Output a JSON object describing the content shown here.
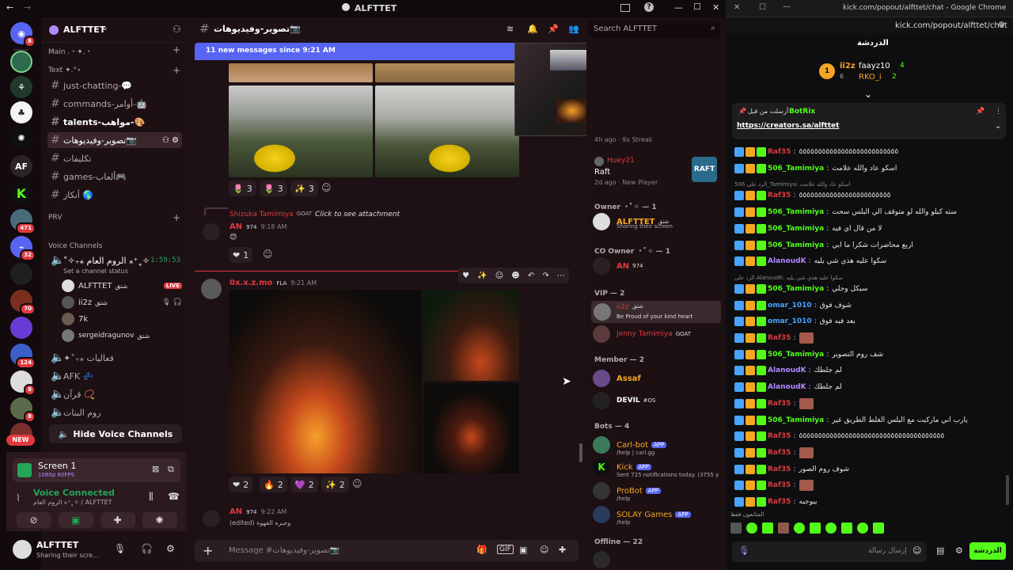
{
  "colors": {
    "accent": "#5865f2",
    "kick_green": "#53fc18",
    "live": "#e03a3e",
    "online": "#23a55a"
  },
  "titlebar": {
    "back": "←",
    "forward": "→",
    "server_name": "ALFTTET",
    "inbox": "inbox-icon",
    "help": "?",
    "min": "—",
    "max": "☐",
    "close": "✕"
  },
  "guilds": [
    {
      "name": "discord-home",
      "badge": "8"
    },
    {
      "name": "server-1"
    },
    {
      "name": "server-2"
    },
    {
      "name": "server-3"
    },
    {
      "name": "server-4"
    },
    {
      "name": "AF",
      "badge": ""
    },
    {
      "name": "K",
      "badge": ""
    },
    {
      "name": "server-7",
      "badge": "471"
    },
    {
      "name": "server-8",
      "badge": "32"
    },
    {
      "name": "server-9"
    },
    {
      "name": "server-10",
      "badge": "70"
    },
    {
      "name": "server-11"
    },
    {
      "name": "server-12",
      "badge": "124"
    },
    {
      "name": "server-13",
      "badge": "8"
    },
    {
      "name": "server-14",
      "badge": "8"
    },
    {
      "name": "server-15"
    },
    {
      "name": "NEW"
    }
  ],
  "server": {
    "name": "ALFTTET",
    "chevron": "⌄"
  },
  "channels": {
    "cat_main": "Main .・✦.・",
    "cat_text": "Text ✦.°⋆",
    "items": [
      "just-chatting-💬",
      "commands-أوامر-🤖",
      "talents-مواهب-🎨",
      "تصوير-وفيديوهات📷",
      "تكليفات",
      "games-ألعاب🎮",
      "أنكاز 🌎"
    ],
    "cat_prv": "PRV",
    "cat_voice": "Voice Channels",
    "voice1": "˚✧₊⁎ الروم العام ⁎⁺˳✧",
    "voice1_time": "1:59:53",
    "voice1_status": "Set a channel status",
    "users": [
      {
        "name": "ALFTTET",
        "tag": "شتق",
        "live": "LIVE"
      },
      {
        "name": "ii2z",
        "tag": "شتق"
      },
      {
        "name": "7k",
        "tag": ""
      },
      {
        "name": "sergeidragunov",
        "tag": "شتق"
      }
    ],
    "voice2": "✦˚₊⁎ فعاليات",
    "voice3": "AFK 💤",
    "voice4": "قرآن 📿",
    "voice5": "روم البنات",
    "hide_voice": "Hide Voice Channels"
  },
  "stream_panel": {
    "title": "Screen 1",
    "quality": "1080p 60FPS",
    "status": "Voice Connected",
    "location": "الروم العام ⁎⁺˳✧ / ALFTTET"
  },
  "user_panel": {
    "name": "ALFTTET",
    "status": "Sharing their scre..."
  },
  "header": {
    "channel": "تصوير-وفيديوهات📷",
    "search_placeholder": "Search ALFTTET"
  },
  "new_messages": {
    "text": "11 new messages since 9:21 AM",
    "mark": "M"
  },
  "messages": [
    {
      "author": "AN",
      "tag": "974",
      "time": "9:18 AM",
      "reply_author": "Shizuka Tamimiya",
      "reply_tag": "GOAT",
      "reply_text": "Click to see attachment",
      "body": "😊",
      "reaction": "1"
    },
    {
      "author": "0x.x.z.mo",
      "tag": "FLA",
      "time": "9:21 AM"
    },
    {
      "author": "AN",
      "tag": "974",
      "time": "9:22 AM",
      "body": "(edited) وجبره القهوة"
    }
  ],
  "reactions1": [
    {
      "emoji": "🌷",
      "count": "3"
    },
    {
      "emoji": "🌷",
      "count": "3"
    },
    {
      "emoji": "✨",
      "count": "3"
    }
  ],
  "reactions2": [
    {
      "emoji": "❤",
      "count": "2"
    },
    {
      "emoji": "🔥",
      "count": "2"
    },
    {
      "emoji": "💜",
      "count": "2"
    },
    {
      "emoji": "✨",
      "count": "2"
    }
  ],
  "composer": {
    "placeholder": "Message #تصوير-وفيديوهات📷"
  },
  "members": {
    "top_time": "4h ago",
    "top_streak": "9x Streak",
    "raft_name": "Raft",
    "raft_time": "2d ago",
    "raft_status": "New Player",
    "raft_user": "Huey21",
    "owner_head": "Owner ・ﾟ✧ — 1",
    "owner": {
      "name": "ALFTTET",
      "tag": "شتق",
      "status": "Sharing their screen"
    },
    "coowner_head": "CO Owner ・ﾟ✧ — 1",
    "coowner": {
      "name": "AN",
      "tag": "974"
    },
    "vip_head": "VIP — 2",
    "vip1": {
      "name": "ii2z",
      "tag": "شتق",
      "status": "Be Proud of your kind heart"
    },
    "vip2": {
      "name": "Jenny Tamimiya",
      "tag": "GOAT"
    },
    "member_head": "Member — 2",
    "mem1": "Assaf",
    "mem2": "DEVIL",
    "mem2_tag": "#OS",
    "bots_head": "Bots — 4",
    "bots": [
      {
        "name": "Carl-bot",
        "tag": "APP",
        "status": "/help | carl.gg"
      },
      {
        "name": "Kick",
        "tag": "APP",
        "status": "Sent 725 notifications today. (3755 y"
      },
      {
        "name": "ProBot",
        "tag": "APP",
        "status": "/help"
      },
      {
        "name": "SOLAY Games",
        "tag": "APP",
        "status": "/help"
      }
    ],
    "offline_head": "Offline — 22"
  },
  "kick": {
    "window_title": "kick.com/popout/alfttet/chat - Google Chrome",
    "url": "kick.com/popout/alfttet/chat",
    "chat_title": "الدردشة",
    "leaderboard": [
      {
        "rank": "1",
        "name": "ii2z",
        "count": "6"
      },
      {
        "name": "faayz10",
        "count": "4"
      },
      {
        "name": "RKO_i",
        "count": "2"
      }
    ],
    "pinned_by": "أرسلت من قبل",
    "pinned_user": "BotRix",
    "pinned_link": "https://creators.sa/alfttet",
    "messages": [
      {
        "user": "Raf35",
        "color": "#e03a3e",
        "text": "٥٥٥٥٥٥٥٥٥٥٥٥٥٥٥٥٥٥٥٥٥٥٥٥٥٥"
      },
      {
        "user": "506_Tamimiya",
        "color": "#53fc18",
        "text": "اسكو عاد والله علامت"
      },
      {
        "reply": "الرد على 506_Tamimiya: اسكو عاد والله علامت"
      },
      {
        "user": "Raf35",
        "color": "#e03a3e",
        "text": "٥٥٥٥٥٥٥٥٥٥٥٥٥٥٥٥٥٥٥٥٥٥٥٥"
      },
      {
        "user": "506_Tamimiya",
        "color": "#53fc18",
        "text": "سته كيلو والله لو متوقف الي البلس سحت"
      },
      {
        "user": "506_Tamimiya",
        "color": "#53fc18",
        "text": "لا من قال اي فيه"
      },
      {
        "user": "506_Tamimiya",
        "color": "#53fc18",
        "text": "اربع محاضرات شكرا ما ابي"
      },
      {
        "user": "AlanoudK",
        "color": "#b388ff",
        "text": "سكوا عليه هذي شي يليه"
      },
      {
        "reply": "الرد على AlanoudK: سكوا عليه هذي شي يليه"
      },
      {
        "user": "506_Tamimiya",
        "color": "#53fc18",
        "text": "سيكل وجلي"
      },
      {
        "user": "omar_1010",
        "color": "#4aa3ff",
        "text": "شوف فوق"
      },
      {
        "user": "omar_1010",
        "color": "#4aa3ff",
        "text": "بعد فيه فوق"
      },
      {
        "user": "Raf35",
        "color": "#e03a3e",
        "text": ""
      },
      {
        "user": "506_Tamimiya",
        "color": "#53fc18",
        "text": "شف روم التصوير"
      },
      {
        "user": "AlanoudK",
        "color": "#b388ff",
        "text": "لم جلطك"
      },
      {
        "user": "AlanoudK",
        "color": "#b388ff",
        "text": "لم جلطك"
      },
      {
        "user": "Raf35",
        "color": "#e03a3e",
        "text": ""
      },
      {
        "user": "506_Tamimiya",
        "color": "#53fc18",
        "text": "يارب اني ماركبت مع البلس الغلط الطريق غير"
      },
      {
        "user": "Raf35",
        "color": "#e03a3e",
        "text": "٥٥٥٥٥٥٥٥٥٥٥٥٥٥٥٥٥٥٥٥٥٥٥٥٥٥٥٥٥٥٥٥٥٥٥٥٥٥"
      },
      {
        "user": "Raf35",
        "color": "#e03a3e",
        "text": ""
      },
      {
        "user": "Raf35",
        "color": "#e03a3e",
        "text": "شوف روم الصور"
      },
      {
        "user": "Raf35",
        "color": "#e03a3e",
        "text": ""
      },
      {
        "user": "Raf35",
        "color": "#e03a3e",
        "text": "يبوجيه"
      }
    ],
    "active_label": "المتابعون فقط",
    "input_placeholder": "إرسال رسالة",
    "send_label": "الدردشة"
  }
}
